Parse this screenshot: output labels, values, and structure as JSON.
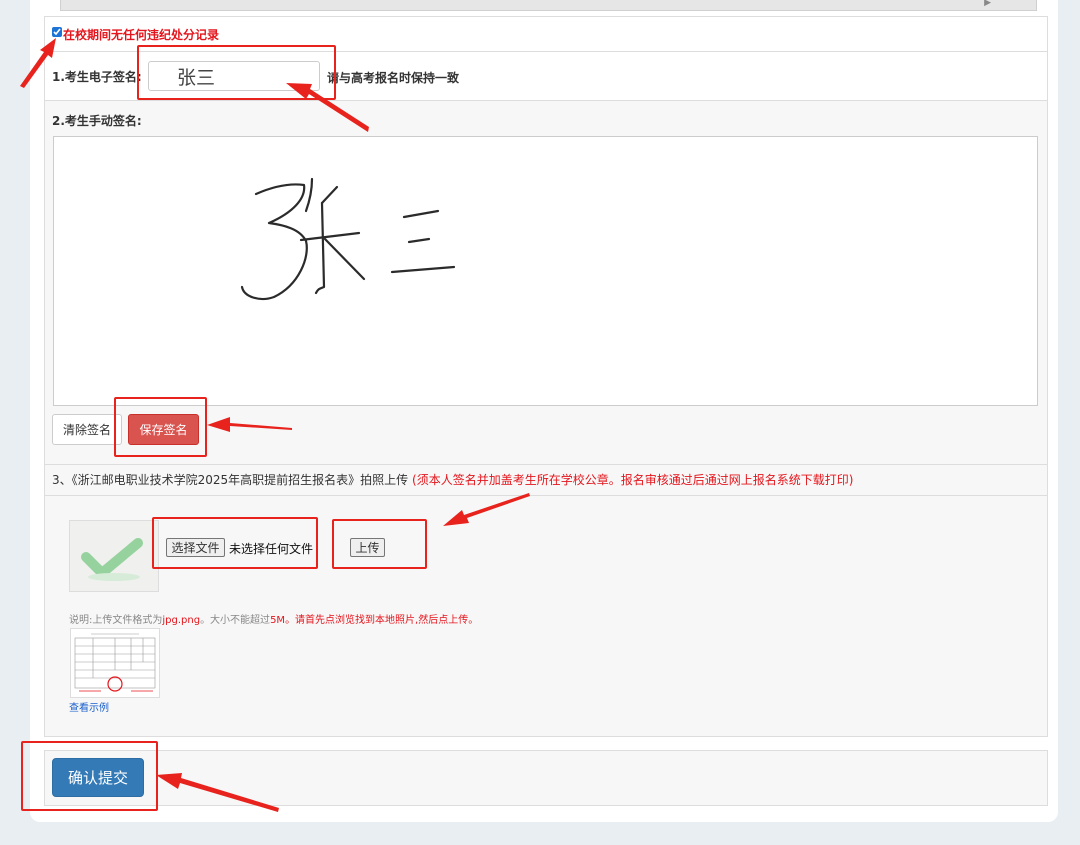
{
  "checkbox": {
    "label": "在校期间无任何违纪处分记录",
    "checked": true
  },
  "e_signature": {
    "label": "1.考生电子签名:",
    "value": "张三",
    "hint": "请与高考报名时保持一致"
  },
  "hand_signature": {
    "label": "2.考生手动签名:",
    "clear_button": "清除签名",
    "save_button": "保存签名"
  },
  "upload_section": {
    "title": "3、《浙江邮电职业技术学院2025年高职提前招生报名表》拍照上传",
    "title_note": "(须本人签名并加盖考生所在学校公章。报名审核通过后通过网上报名系统下载打印)",
    "choose_file_button": "选择文件",
    "file_status": "未选择任何文件",
    "upload_button": "上传",
    "note_prefix": "说明:上传文件格式为",
    "note_formats": "jpg.png",
    "note_middle": "。大小不能超过",
    "note_size": "5M",
    "note_suffix": "。请首先点浏览找到本地照片,然后点上传。",
    "sample_link": "查看示例"
  },
  "submit_button": "确认提交",
  "colors": {
    "accent_blue": "#337ab7",
    "danger_red": "#d9534f",
    "annotation_red": "#e8231d",
    "warning_text": "#e4151c"
  }
}
